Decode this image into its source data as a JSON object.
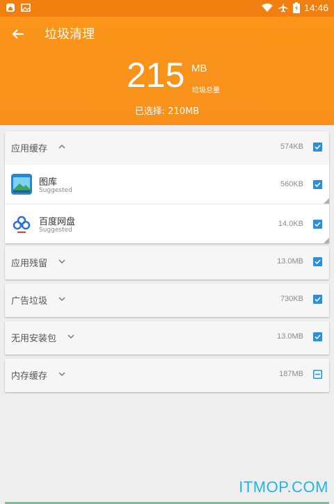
{
  "status_bar": {
    "time": "14:46"
  },
  "header": {
    "title": "垃圾清理",
    "total_value": "215",
    "total_unit": "MB",
    "total_label": "垃圾总量",
    "selected_text": "已选择: 210MB"
  },
  "colors": {
    "accent": "#f7911c",
    "checkbox": "#2f8fd6"
  },
  "categories": [
    {
      "label": "应用缓存",
      "size": "574KB",
      "expanded": true
    },
    {
      "label": "应用残留",
      "size": "13.0MB"
    },
    {
      "label": "广告垃圾",
      "size": "730KB"
    },
    {
      "label": "无用安装包",
      "size": "13.0MB"
    },
    {
      "label": "内存缓存",
      "size": "187MB"
    }
  ],
  "apps": [
    {
      "name": "图库",
      "sub": "Suggested",
      "size": "560KB",
      "icon": "gallery-icon"
    },
    {
      "name": "百度网盘",
      "sub": "Suggested",
      "size": "14.0KB",
      "icon": "baidu-netdisk-icon"
    }
  ],
  "watermark": "ITMOP.COM"
}
